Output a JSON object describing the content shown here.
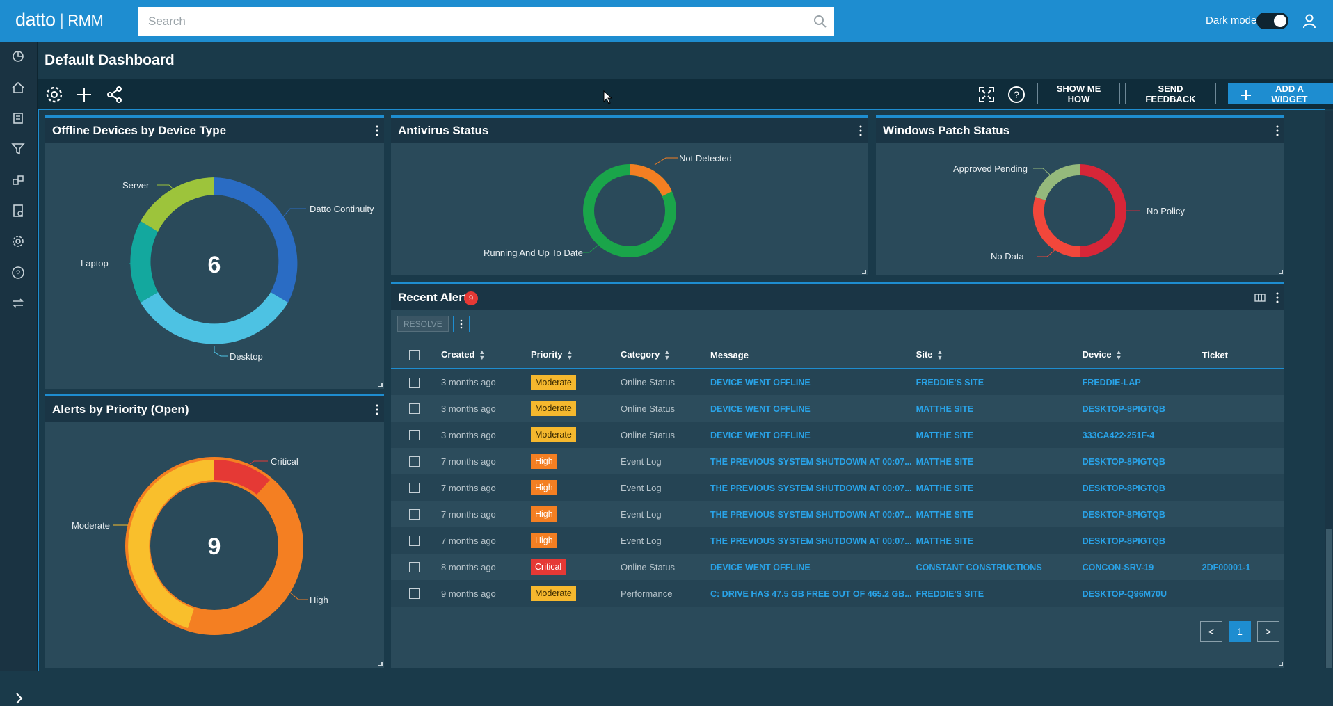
{
  "app": {
    "brand": "datto",
    "product": "RMM",
    "search_placeholder": "Search",
    "dark_mode_label": "Dark mode"
  },
  "page": {
    "title": "Default Dashboard"
  },
  "toolbar": {
    "show_me_how": "SHOW ME HOW",
    "send_feedback": "SEND FEEDBACK",
    "add_widget": "ADD A WIDGET"
  },
  "widgets": {
    "offline_devices": {
      "title": "Offline Devices by Device Type",
      "total": "6",
      "labels": [
        "Server",
        "Datto Continuity",
        "Laptop",
        "Desktop"
      ]
    },
    "antivirus": {
      "title": "Antivirus Status",
      "labels": [
        "Not Detected",
        "Running And Up To Date"
      ]
    },
    "patch": {
      "title": "Windows Patch Status",
      "labels": [
        "Approved Pending",
        "No Policy",
        "No Data"
      ]
    },
    "alerts_priority": {
      "title": "Alerts by Priority (Open)",
      "total": "9",
      "labels": [
        "Critical",
        "Moderate",
        "High"
      ]
    },
    "recent_alerts": {
      "title": "Recent Alerts",
      "count": "9",
      "resolve_label": "RESOLVE",
      "columns": [
        "Created",
        "Priority",
        "Category",
        "Message",
        "Site",
        "Device",
        "Ticket"
      ],
      "rows": [
        {
          "created": "3 months ago",
          "priority": "Moderate",
          "category": "Online Status",
          "message": "DEVICE WENT OFFLINE",
          "site": "FREDDIE'S SITE",
          "device": "FREDDIE-LAP",
          "ticket": ""
        },
        {
          "created": "3 months ago",
          "priority": "Moderate",
          "category": "Online Status",
          "message": "DEVICE WENT OFFLINE",
          "site": "MATTHE SITE",
          "device": "DESKTOP-8PIGTQB",
          "ticket": ""
        },
        {
          "created": "3 months ago",
          "priority": "Moderate",
          "category": "Online Status",
          "message": "DEVICE WENT OFFLINE",
          "site": "MATTHE SITE",
          "device": "333CA422-251F-4",
          "ticket": ""
        },
        {
          "created": "7 months ago",
          "priority": "High",
          "category": "Event Log",
          "message": "THE PREVIOUS SYSTEM SHUTDOWN AT 00:07...",
          "site": "MATTHE SITE",
          "device": "DESKTOP-8PIGTQB",
          "ticket": ""
        },
        {
          "created": "7 months ago",
          "priority": "High",
          "category": "Event Log",
          "message": "THE PREVIOUS SYSTEM SHUTDOWN AT 00:07...",
          "site": "MATTHE SITE",
          "device": "DESKTOP-8PIGTQB",
          "ticket": ""
        },
        {
          "created": "7 months ago",
          "priority": "High",
          "category": "Event Log",
          "message": "THE PREVIOUS SYSTEM SHUTDOWN AT 00:07...",
          "site": "MATTHE SITE",
          "device": "DESKTOP-8PIGTQB",
          "ticket": ""
        },
        {
          "created": "7 months ago",
          "priority": "High",
          "category": "Event Log",
          "message": "THE PREVIOUS SYSTEM SHUTDOWN AT 00:07...",
          "site": "MATTHE SITE",
          "device": "DESKTOP-8PIGTQB",
          "ticket": ""
        },
        {
          "created": "8 months ago",
          "priority": "Critical",
          "category": "Online Status",
          "message": "DEVICE WENT OFFLINE",
          "site": "CONSTANT CONSTRUCTIONS",
          "device": "CONCON-SRV-19",
          "ticket": "2DF00001-1"
        },
        {
          "created": "9 months ago",
          "priority": "Moderate",
          "category": "Performance",
          "message": "C: DRIVE HAS 47.5 GB FREE OUT OF 465.2 GB...",
          "site": "FREDDIE'S SITE",
          "device": "DESKTOP-Q96M70U",
          "ticket": ""
        }
      ],
      "pagination": {
        "prev": "<",
        "current": "1",
        "next": ">"
      }
    }
  },
  "colors": {
    "accent": "#1e8dd0",
    "moderate": "#f5b82e",
    "high": "#f47f22",
    "critical": "#e53935"
  }
}
